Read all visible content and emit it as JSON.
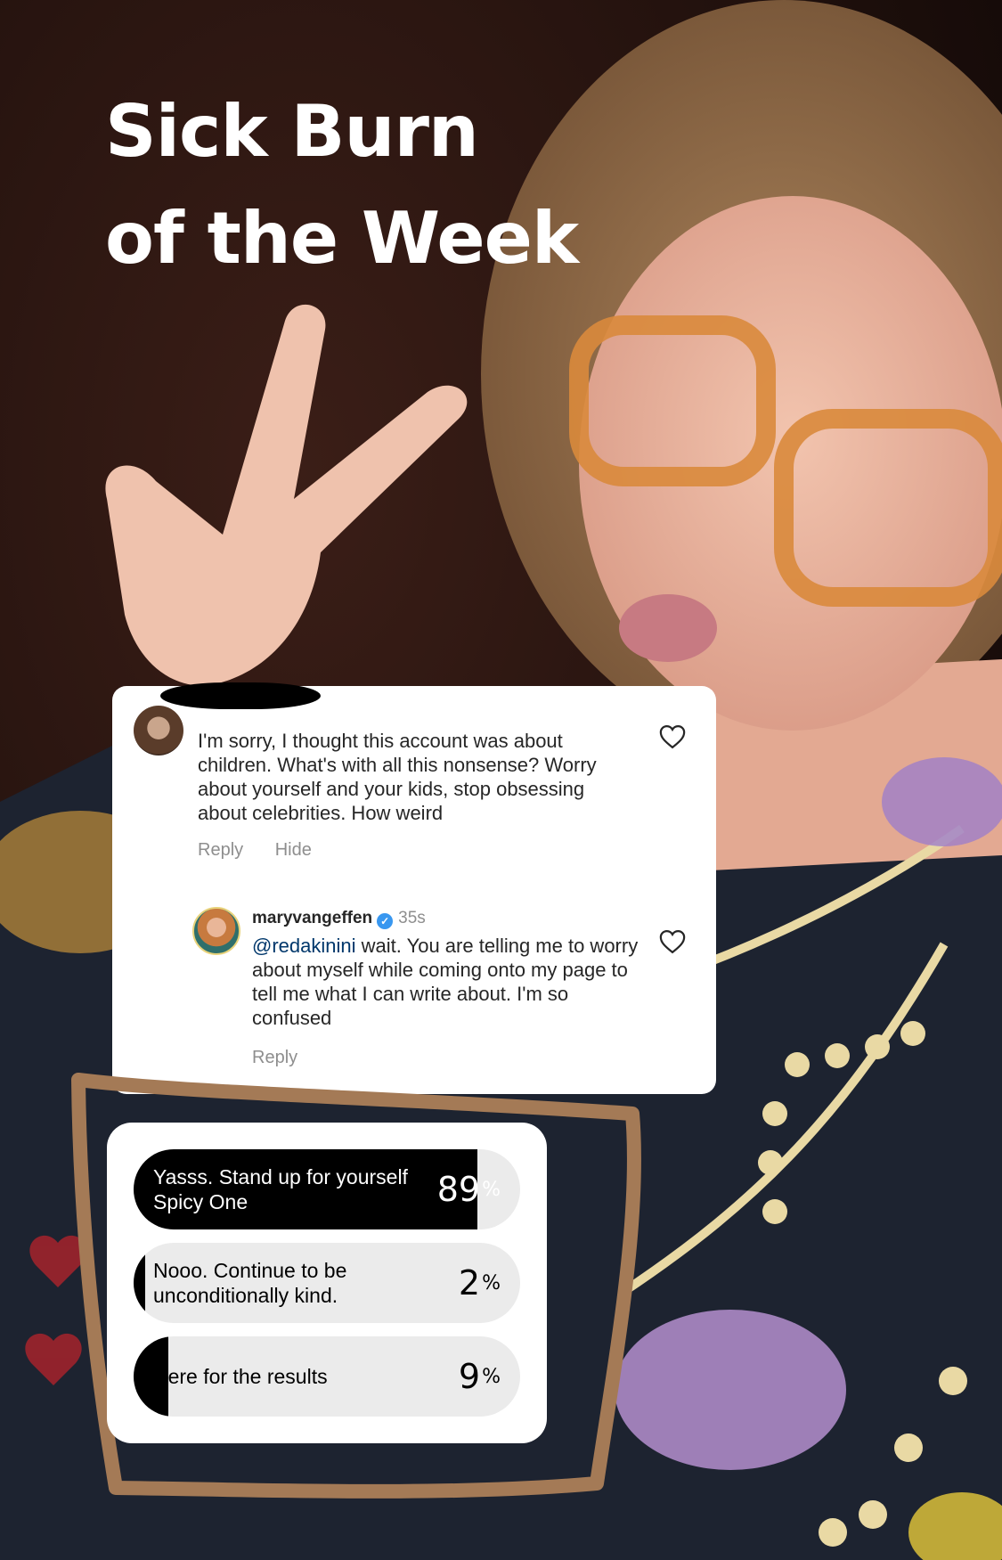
{
  "headline": {
    "line1": "Sick Burn",
    "line2": "of the Week"
  },
  "comment": {
    "text": "I'm sorry, I thought this account was about children. What's with all this nonsense? Worry about yourself and your kids, stop obsessing about celebrities. How weird",
    "reply_label": "Reply",
    "hide_label": "Hide",
    "like_icon": "heart-outline-icon"
  },
  "reply": {
    "username": "maryvangeffen",
    "verified": "verified-badge-icon",
    "time": "35s",
    "mention": "@redakinini",
    "text": " wait. You are telling me to worry about myself while coming onto my page to tell me what I can write about. I'm so confused",
    "reply_label": "Reply",
    "like_icon": "heart-outline-icon"
  },
  "poll": {
    "options": [
      {
        "label": "Yasss. Stand up for yourself Spicy One",
        "percent": 89,
        "percent_label": "89",
        "percent_sign": "%"
      },
      {
        "label": "Nooo. Continue to be unconditionally kind.",
        "percent": 2,
        "percent_label": "2",
        "percent_sign": "%"
      },
      {
        "label": "Here for the results",
        "percent": 9,
        "percent_label": "9",
        "percent_sign": "%"
      }
    ],
    "fill_color": "#000000",
    "track_color": "#ebebeb"
  },
  "colors": {
    "frame": "#a47a56",
    "link": "#00376b",
    "verified": "#3897f0"
  }
}
